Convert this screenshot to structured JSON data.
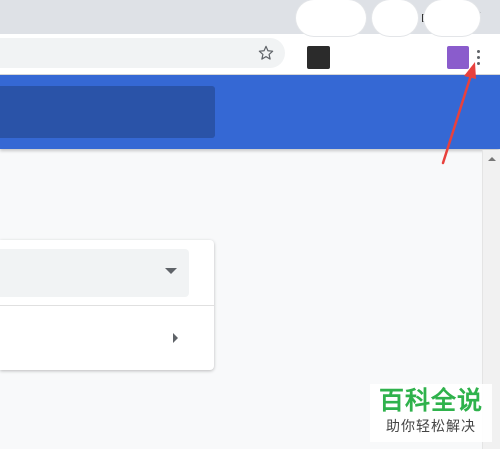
{
  "window": {
    "controls": {
      "minimize_icon": "minimize-icon",
      "restore_icon": "restore-icon",
      "close_icon": "close-icon"
    }
  },
  "toolbar": {
    "bookmark_icon": "star-icon",
    "extensions": [
      {
        "icon": "extension-icon",
        "color": "#2b2b2b"
      },
      {
        "icon": "extension-icon",
        "color": "#8a5ccc"
      }
    ],
    "menu_icon": "more-vert-icon"
  },
  "colors": {
    "header": "#3568d4",
    "header_search": "#2a53a8",
    "annotation_arrow": "#e8413d",
    "watermark_green": "#2fb24c"
  },
  "card": {
    "dropdown_icon": "caret-down-icon",
    "row_icon": "caret-right-icon"
  },
  "watermark": {
    "title": "百科全说",
    "subtitle": "助你轻松解决"
  }
}
